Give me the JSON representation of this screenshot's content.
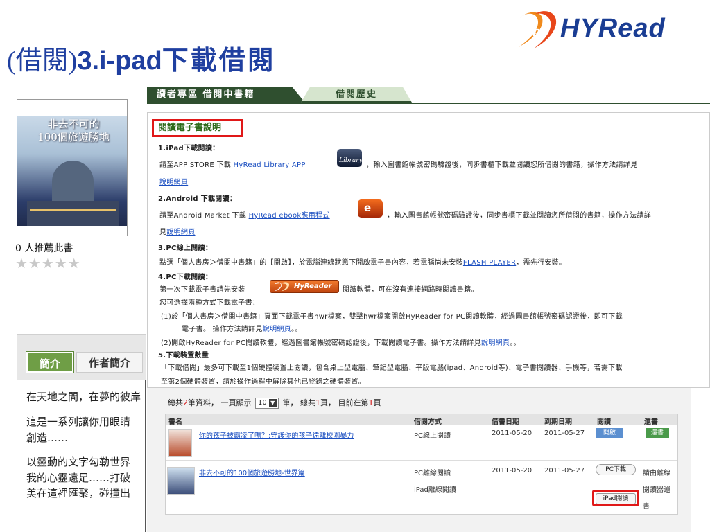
{
  "slide": {
    "title_paren": "(借閱)",
    "title_bold": "3.i-pad",
    "title_cjk": "下載借閱"
  },
  "logo": {
    "text": "HYRead"
  },
  "book": {
    "cover_title_1": "非去不可的",
    "cover_title_2": "100個旅遊勝地",
    "recommend": "0 人推薦此書",
    "stars": "★★★★★",
    "stars_filled": 0
  },
  "intro": {
    "tab_intro": "簡介",
    "tab_author": "作者簡介",
    "lines": [
      "在天地之間，在夢的彼岸",
      "這是一系列讓你用眼睛",
      "創造……",
      "以靈動的文字勾勒世界",
      "我的心靈遠足……打破",
      "美在這裡匯聚，碰撞出"
    ]
  },
  "main_tabs": {
    "reader": "讀者專區  借閱中書籍",
    "history": "借閱歷史"
  },
  "info": {
    "title": "閱讀電子書說明",
    "s1_head": "1.iPad下載閱讀：",
    "s1_a": "請至APP STORE 下載 ",
    "s1_link": "HyRead Library APP",
    "s1_b": "，輸入圖書館帳號密碼驗證後，同步書櫃下載並閱讀您所借閱的書籍，操作方法請詳見",
    "s1_c": "說明網頁",
    "s2_head": "2.Android 下載閱讀：",
    "s2_a": "請至Android Market 下載 ",
    "s2_link": "HyRead ebook應用程式",
    "s2_b": "，輸入圖書館帳號密碼驗證後，同步書櫃下載並閱讀您所借閱的書籍，操作方法請詳",
    "s2_c1": "見",
    "s2_c2": "說明網頁",
    "s3_head": "3.PC線上閱讀：",
    "s3_a": "點選「個人書房＞借閱中書籍」的【開啟】，於電腦連線狀態下開啟電子書內容，若電腦尚未安裝",
    "s3_link": "FLASH PLAYER",
    "s3_b": "，需先行安裝。",
    "s4_head": "4.PC下載閱讀：",
    "s4_a1": "第一次下載電子書請先安裝",
    "s4_badge": "HyReader",
    "s4_a2": "閱讀軟體，可在沒有連接網路時閱讀書籍。",
    "s4_b": "您可選擇兩種方式下載電子書：",
    "s4_c": "(1)於「個人書房＞借閱中書籍」頁面下載電子書hwr檔案，雙擊hwr檔案開啟HyReader for PC閱讀軟體，經過圖書館帳號密碼認證後，即可下載",
    "s4_d1": "電子書。 操作方法請詳見",
    "s4_d2": "說明網頁",
    "s4_d3": "。。",
    "s4_e1": "(2)開啟HyReader for PC閱讀軟體，經過圖書館帳號密碼認證後，下載閱讀電子書。操作方法請詳見",
    "s4_e2": "說明網頁",
    "s4_e3": "。。",
    "s5_head": "5.下載裝置數量",
    "s5_a": "「下載借閱」最多可下載至1個硬體裝置上閱讀，包含桌上型電腦、筆記型電腦、平版電腦(ipad、Android等)、電子書閱讀器、手機等，若需下載",
    "s5_b": "至第2個硬體裝置，請於操作過程中解除其他已登錄之硬體裝置。"
  },
  "summary": {
    "a": "總共",
    "total": "2",
    "b": "筆資料，  一頁顯示",
    "page_size": "10",
    "c": "筆，  總共",
    "pages": "1",
    "d": "頁，  目前在第",
    "current": "1",
    "e": "頁"
  },
  "table": {
    "headers": [
      "書名",
      "借閱方式",
      "借書日期",
      "到期日期",
      "閱讀",
      "還書"
    ],
    "rows": [
      {
        "title": "你的孩子被霸凌了嗎？:守護你的孩子遠離校園暴力",
        "method": "PC線上閱讀",
        "method2": "",
        "borrow_date": "2011-05-20",
        "due_date": "2011-05-27",
        "read": "開啟",
        "return": "還書"
      },
      {
        "title": "非去不可的100個旅遊勝地-世界篇",
        "method": "PC離線閱讀",
        "method2": "iPad離線閱讀",
        "borrow_date": "2011-05-20",
        "due_date": "2011-05-27",
        "read_pc": "PC下載",
        "read_ipad": "iPad閱讀",
        "return_1": "請由離線",
        "return_2": "閱讀器還",
        "return_3": "書"
      }
    ]
  },
  "colors": {
    "title_blue": "#1f3fa0",
    "highlight_red": "#e01818",
    "tab_green": "#6f9e46",
    "link_blue": "#1a4ec0"
  }
}
